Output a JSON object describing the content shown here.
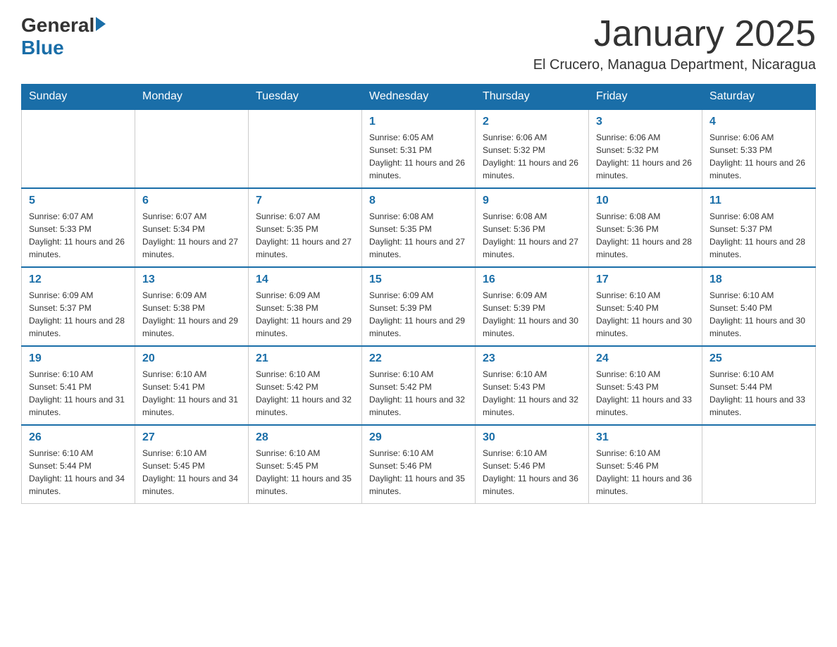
{
  "header": {
    "logo": {
      "general": "General",
      "blue": "Blue"
    },
    "title": "January 2025",
    "subtitle": "El Crucero, Managua Department, Nicaragua"
  },
  "days_of_week": [
    "Sunday",
    "Monday",
    "Tuesday",
    "Wednesday",
    "Thursday",
    "Friday",
    "Saturday"
  ],
  "weeks": [
    [
      {
        "day": "",
        "info": ""
      },
      {
        "day": "",
        "info": ""
      },
      {
        "day": "",
        "info": ""
      },
      {
        "day": "1",
        "info": "Sunrise: 6:05 AM\nSunset: 5:31 PM\nDaylight: 11 hours and 26 minutes."
      },
      {
        "day": "2",
        "info": "Sunrise: 6:06 AM\nSunset: 5:32 PM\nDaylight: 11 hours and 26 minutes."
      },
      {
        "day": "3",
        "info": "Sunrise: 6:06 AM\nSunset: 5:32 PM\nDaylight: 11 hours and 26 minutes."
      },
      {
        "day": "4",
        "info": "Sunrise: 6:06 AM\nSunset: 5:33 PM\nDaylight: 11 hours and 26 minutes."
      }
    ],
    [
      {
        "day": "5",
        "info": "Sunrise: 6:07 AM\nSunset: 5:33 PM\nDaylight: 11 hours and 26 minutes."
      },
      {
        "day": "6",
        "info": "Sunrise: 6:07 AM\nSunset: 5:34 PM\nDaylight: 11 hours and 27 minutes."
      },
      {
        "day": "7",
        "info": "Sunrise: 6:07 AM\nSunset: 5:35 PM\nDaylight: 11 hours and 27 minutes."
      },
      {
        "day": "8",
        "info": "Sunrise: 6:08 AM\nSunset: 5:35 PM\nDaylight: 11 hours and 27 minutes."
      },
      {
        "day": "9",
        "info": "Sunrise: 6:08 AM\nSunset: 5:36 PM\nDaylight: 11 hours and 27 minutes."
      },
      {
        "day": "10",
        "info": "Sunrise: 6:08 AM\nSunset: 5:36 PM\nDaylight: 11 hours and 28 minutes."
      },
      {
        "day": "11",
        "info": "Sunrise: 6:08 AM\nSunset: 5:37 PM\nDaylight: 11 hours and 28 minutes."
      }
    ],
    [
      {
        "day": "12",
        "info": "Sunrise: 6:09 AM\nSunset: 5:37 PM\nDaylight: 11 hours and 28 minutes."
      },
      {
        "day": "13",
        "info": "Sunrise: 6:09 AM\nSunset: 5:38 PM\nDaylight: 11 hours and 29 minutes."
      },
      {
        "day": "14",
        "info": "Sunrise: 6:09 AM\nSunset: 5:38 PM\nDaylight: 11 hours and 29 minutes."
      },
      {
        "day": "15",
        "info": "Sunrise: 6:09 AM\nSunset: 5:39 PM\nDaylight: 11 hours and 29 minutes."
      },
      {
        "day": "16",
        "info": "Sunrise: 6:09 AM\nSunset: 5:39 PM\nDaylight: 11 hours and 30 minutes."
      },
      {
        "day": "17",
        "info": "Sunrise: 6:10 AM\nSunset: 5:40 PM\nDaylight: 11 hours and 30 minutes."
      },
      {
        "day": "18",
        "info": "Sunrise: 6:10 AM\nSunset: 5:40 PM\nDaylight: 11 hours and 30 minutes."
      }
    ],
    [
      {
        "day": "19",
        "info": "Sunrise: 6:10 AM\nSunset: 5:41 PM\nDaylight: 11 hours and 31 minutes."
      },
      {
        "day": "20",
        "info": "Sunrise: 6:10 AM\nSunset: 5:41 PM\nDaylight: 11 hours and 31 minutes."
      },
      {
        "day": "21",
        "info": "Sunrise: 6:10 AM\nSunset: 5:42 PM\nDaylight: 11 hours and 32 minutes."
      },
      {
        "day": "22",
        "info": "Sunrise: 6:10 AM\nSunset: 5:42 PM\nDaylight: 11 hours and 32 minutes."
      },
      {
        "day": "23",
        "info": "Sunrise: 6:10 AM\nSunset: 5:43 PM\nDaylight: 11 hours and 32 minutes."
      },
      {
        "day": "24",
        "info": "Sunrise: 6:10 AM\nSunset: 5:43 PM\nDaylight: 11 hours and 33 minutes."
      },
      {
        "day": "25",
        "info": "Sunrise: 6:10 AM\nSunset: 5:44 PM\nDaylight: 11 hours and 33 minutes."
      }
    ],
    [
      {
        "day": "26",
        "info": "Sunrise: 6:10 AM\nSunset: 5:44 PM\nDaylight: 11 hours and 34 minutes."
      },
      {
        "day": "27",
        "info": "Sunrise: 6:10 AM\nSunset: 5:45 PM\nDaylight: 11 hours and 34 minutes."
      },
      {
        "day": "28",
        "info": "Sunrise: 6:10 AM\nSunset: 5:45 PM\nDaylight: 11 hours and 35 minutes."
      },
      {
        "day": "29",
        "info": "Sunrise: 6:10 AM\nSunset: 5:46 PM\nDaylight: 11 hours and 35 minutes."
      },
      {
        "day": "30",
        "info": "Sunrise: 6:10 AM\nSunset: 5:46 PM\nDaylight: 11 hours and 36 minutes."
      },
      {
        "day": "31",
        "info": "Sunrise: 6:10 AM\nSunset: 5:46 PM\nDaylight: 11 hours and 36 minutes."
      },
      {
        "day": "",
        "info": ""
      }
    ]
  ]
}
